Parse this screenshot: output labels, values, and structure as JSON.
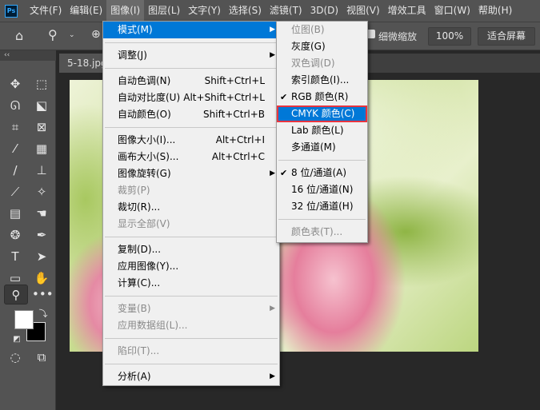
{
  "menubar": {
    "logo": "Ps",
    "items": [
      "文件(F)",
      "编辑(E)",
      "图像(I)",
      "图层(L)",
      "文字(Y)",
      "选择(S)",
      "滤镜(T)",
      "3D(D)",
      "视图(V)",
      "增效工具",
      "窗口(W)",
      "帮助(H)"
    ]
  },
  "options": {
    "fine_zoom": "细微缩放",
    "zoom_value": "100%",
    "fit_screen": "适合屏幕"
  },
  "document": {
    "tab": "5-18.jpg"
  },
  "image_menu": {
    "items": [
      {
        "label": "模式(M)",
        "submenu": true
      },
      {
        "label": "调整(J)",
        "submenu": true
      },
      {
        "label": "自动色调(N)",
        "shortcut": "Shift+Ctrl+L"
      },
      {
        "label": "自动对比度(U)",
        "shortcut": "Alt+Shift+Ctrl+L"
      },
      {
        "label": "自动颜色(O)",
        "shortcut": "Shift+Ctrl+B"
      },
      {
        "label": "图像大小(I)...",
        "shortcut": "Alt+Ctrl+I"
      },
      {
        "label": "画布大小(S)...",
        "shortcut": "Alt+Ctrl+C"
      },
      {
        "label": "图像旋转(G)",
        "submenu": true
      },
      {
        "label": "裁剪(P)",
        "disabled": true
      },
      {
        "label": "裁切(R)..."
      },
      {
        "label": "显示全部(V)",
        "disabled": true
      },
      {
        "label": "复制(D)..."
      },
      {
        "label": "应用图像(Y)..."
      },
      {
        "label": "计算(C)..."
      },
      {
        "label": "变量(B)",
        "disabled": true,
        "submenu": true
      },
      {
        "label": "应用数据组(L)...",
        "disabled": true
      },
      {
        "label": "陷印(T)...",
        "disabled": true
      },
      {
        "label": "分析(A)",
        "submenu": true
      }
    ]
  },
  "mode_submenu": {
    "items": [
      {
        "label": "位图(B)",
        "disabled": true
      },
      {
        "label": "灰度(G)"
      },
      {
        "label": "双色调(D)",
        "disabled": true
      },
      {
        "label": "索引颜色(I)..."
      },
      {
        "label": "RGB 颜色(R)",
        "checked": true
      },
      {
        "label": "CMYK 颜色(C)",
        "highlighted": true
      },
      {
        "label": "Lab 颜色(L)"
      },
      {
        "label": "多通道(M)"
      },
      {
        "label": "8 位/通道(A)",
        "checked": true
      },
      {
        "label": "16 位/通道(N)"
      },
      {
        "label": "32 位/通道(H)"
      },
      {
        "label": "颜色表(T)...",
        "disabled": true
      }
    ]
  },
  "colors": {
    "highlight": "#0078d7",
    "callout": "#e8343f"
  }
}
